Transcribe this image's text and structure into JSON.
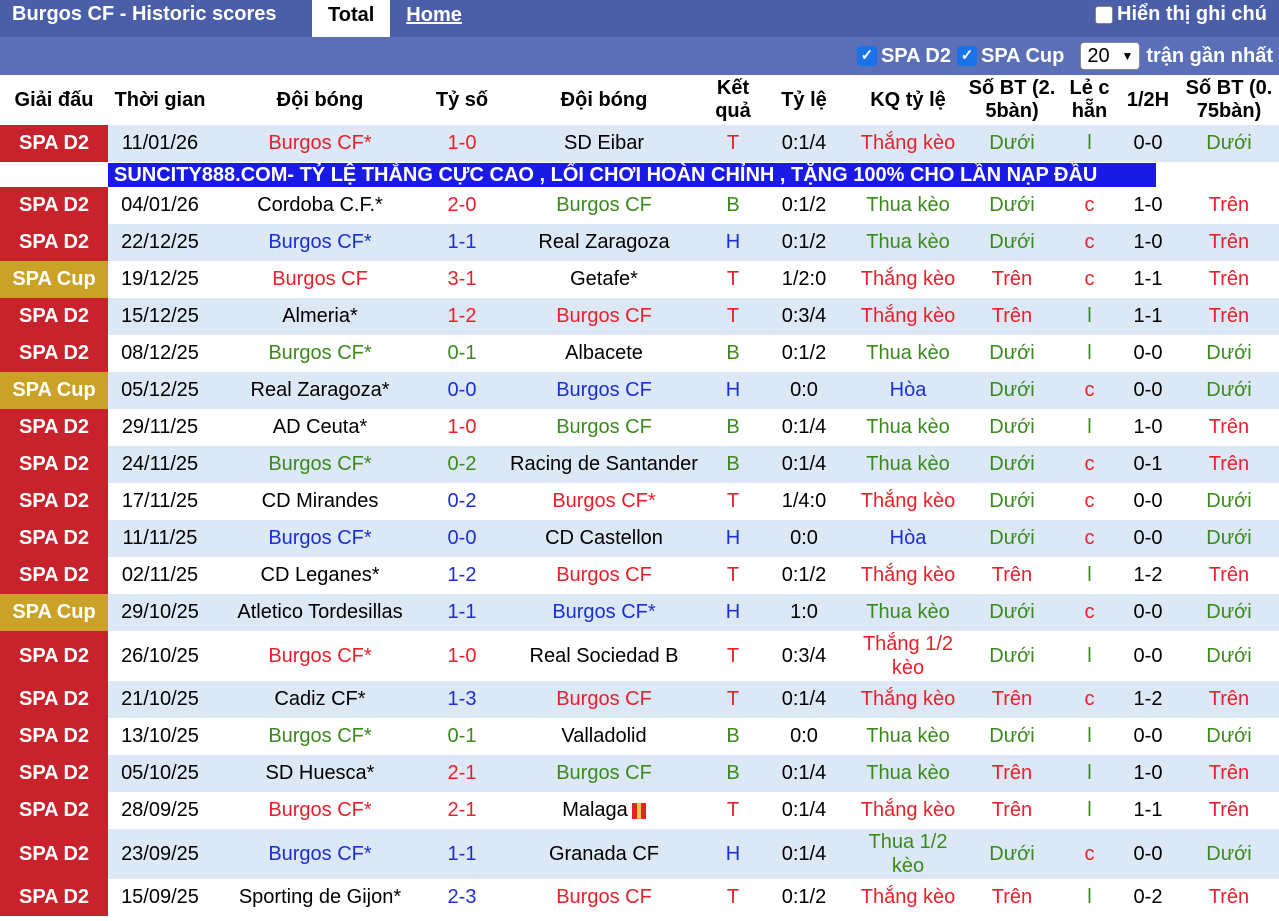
{
  "header": {
    "title": "Burgos CF - Historic scores",
    "tabs": [
      "Total",
      "Home"
    ],
    "toggle_label": "Hiển thị ghi chú"
  },
  "filters": {
    "spa_d2": "SPA D2",
    "spa_cup": "SPA Cup",
    "count_value": "20",
    "count_suffix": "trận gần nhất"
  },
  "columns": [
    "Giải đấu",
    "Thời gian",
    "Đội bóng",
    "Tỷ số",
    "Đội bóng",
    "Kết quả",
    "Tỷ lệ",
    "KQ tỷ lệ",
    "Số BT (2. 5bàn)",
    "Lẻ c hẵn",
    "1/2H",
    "Số BT (0. 75bàn)"
  ],
  "colors": {
    "d2": "#c8232c",
    "cup": "#c9a227",
    "red": "#e8202a",
    "blue": "#1a2fd6",
    "green": "#3a8a1e"
  },
  "ad_text": "SUNCITY888.COM- TỶ LỆ THẮNG CỰC CAO , LỐI CHƠI HOÀN CHỈNH , TẶNG 100% CHO LẦN NẠP ĐẦU",
  "rows": [
    {
      "league": "SPA D2",
      "date": "11/01/26",
      "home": "Burgos CF*",
      "home_c": "red",
      "score": "1-0",
      "score_c": "red",
      "away": "SD Eibar",
      "away_c": "black",
      "res": "T",
      "res_c": "red",
      "odds": "0:1/4",
      "kq": "Thắng kèo",
      "kq_c": "red",
      "bt25": "Dưới",
      "bt25_c": "green",
      "le": "l",
      "le_c": "green",
      "half": "0-0",
      "bt075": "Dưới",
      "bt075_c": "green"
    },
    {
      "league": "SPA D2",
      "date": "04/01/26",
      "home": "Cordoba C.F.*",
      "home_c": "black",
      "score": "2-0",
      "score_c": "red",
      "away": "Burgos CF",
      "away_c": "green",
      "res": "B",
      "res_c": "green",
      "odds": "0:1/2",
      "kq": "Thua kèo",
      "kq_c": "green",
      "bt25": "Dưới",
      "bt25_c": "green",
      "le": "c",
      "le_c": "red",
      "half": "1-0",
      "bt075": "Trên",
      "bt075_c": "red"
    },
    {
      "league": "SPA D2",
      "date": "22/12/25",
      "home": "Burgos CF*",
      "home_c": "blue",
      "score": "1-1",
      "score_c": "blue",
      "away": "Real Zaragoza",
      "away_c": "black",
      "res": "H",
      "res_c": "blue",
      "odds": "0:1/2",
      "kq": "Thua kèo",
      "kq_c": "green",
      "bt25": "Dưới",
      "bt25_c": "green",
      "le": "c",
      "le_c": "red",
      "half": "1-0",
      "bt075": "Trên",
      "bt075_c": "red"
    },
    {
      "league": "SPA Cup",
      "date": "19/12/25",
      "home": "Burgos CF",
      "home_c": "red",
      "score": "3-1",
      "score_c": "red",
      "away": "Getafe*",
      "away_c": "black",
      "res": "T",
      "res_c": "red",
      "odds": "1/2:0",
      "kq": "Thắng kèo",
      "kq_c": "red",
      "bt25": "Trên",
      "bt25_c": "red",
      "le": "c",
      "le_c": "red",
      "half": "1-1",
      "bt075": "Trên",
      "bt075_c": "red"
    },
    {
      "league": "SPA D2",
      "date": "15/12/25",
      "home": "Almeria*",
      "home_c": "black",
      "score": "1-2",
      "score_c": "red",
      "away": "Burgos CF",
      "away_c": "red",
      "res": "T",
      "res_c": "red",
      "odds": "0:3/4",
      "kq": "Thắng kèo",
      "kq_c": "red",
      "bt25": "Trên",
      "bt25_c": "red",
      "le": "l",
      "le_c": "green",
      "half": "1-1",
      "bt075": "Trên",
      "bt075_c": "red"
    },
    {
      "league": "SPA D2",
      "date": "08/12/25",
      "home": "Burgos CF*",
      "home_c": "green",
      "score": "0-1",
      "score_c": "green",
      "away": "Albacete",
      "away_c": "black",
      "res": "B",
      "res_c": "green",
      "odds": "0:1/2",
      "kq": "Thua kèo",
      "kq_c": "green",
      "bt25": "Dưới",
      "bt25_c": "green",
      "le": "l",
      "le_c": "green",
      "half": "0-0",
      "bt075": "Dưới",
      "bt075_c": "green"
    },
    {
      "league": "SPA Cup",
      "date": "05/12/25",
      "home": "Real Zaragoza*",
      "home_c": "black",
      "score": "0-0",
      "score_c": "blue",
      "away": "Burgos CF",
      "away_c": "blue",
      "res": "H",
      "res_c": "blue",
      "odds": "0:0",
      "kq": "Hòa",
      "kq_c": "blue",
      "bt25": "Dưới",
      "bt25_c": "green",
      "le": "c",
      "le_c": "red",
      "half": "0-0",
      "bt075": "Dưới",
      "bt075_c": "green"
    },
    {
      "league": "SPA D2",
      "date": "29/11/25",
      "home": "AD Ceuta*",
      "home_c": "black",
      "score": "1-0",
      "score_c": "red",
      "away": "Burgos CF",
      "away_c": "green",
      "res": "B",
      "res_c": "green",
      "odds": "0:1/4",
      "kq": "Thua kèo",
      "kq_c": "green",
      "bt25": "Dưới",
      "bt25_c": "green",
      "le": "l",
      "le_c": "green",
      "half": "1-0",
      "bt075": "Trên",
      "bt075_c": "red"
    },
    {
      "league": "SPA D2",
      "date": "24/11/25",
      "home": "Burgos CF*",
      "home_c": "green",
      "score": "0-2",
      "score_c": "green",
      "away": "Racing de Santander",
      "away_c": "black",
      "res": "B",
      "res_c": "green",
      "odds": "0:1/4",
      "kq": "Thua kèo",
      "kq_c": "green",
      "bt25": "Dưới",
      "bt25_c": "green",
      "le": "c",
      "le_c": "red",
      "half": "0-1",
      "bt075": "Trên",
      "bt075_c": "red"
    },
    {
      "league": "SPA D2",
      "date": "17/11/25",
      "home": "CD Mirandes",
      "home_c": "black",
      "score": "0-2",
      "score_c": "blue",
      "away": "Burgos CF*",
      "away_c": "red",
      "res": "T",
      "res_c": "red",
      "odds": "1/4:0",
      "kq": "Thắng kèo",
      "kq_c": "red",
      "bt25": "Dưới",
      "bt25_c": "green",
      "le": "c",
      "le_c": "red",
      "half": "0-0",
      "bt075": "Dưới",
      "bt075_c": "green"
    },
    {
      "league": "SPA D2",
      "date": "11/11/25",
      "home": "Burgos CF*",
      "home_c": "blue",
      "score": "0-0",
      "score_c": "blue",
      "away": "CD Castellon",
      "away_c": "black",
      "res": "H",
      "res_c": "blue",
      "odds": "0:0",
      "kq": "Hòa",
      "kq_c": "blue",
      "bt25": "Dưới",
      "bt25_c": "green",
      "le": "c",
      "le_c": "red",
      "half": "0-0",
      "bt075": "Dưới",
      "bt075_c": "green"
    },
    {
      "league": "SPA D2",
      "date": "02/11/25",
      "home": "CD Leganes*",
      "home_c": "black",
      "score": "1-2",
      "score_c": "blue",
      "away": "Burgos CF",
      "away_c": "red",
      "res": "T",
      "res_c": "red",
      "odds": "0:1/2",
      "kq": "Thắng kèo",
      "kq_c": "red",
      "bt25": "Trên",
      "bt25_c": "red",
      "le": "l",
      "le_c": "green",
      "half": "1-2",
      "bt075": "Trên",
      "bt075_c": "red"
    },
    {
      "league": "SPA Cup",
      "date": "29/10/25",
      "home": "Atletico Tordesillas",
      "home_c": "black",
      "score": "1-1",
      "score_c": "blue",
      "away": "Burgos CF*",
      "away_c": "blue",
      "res": "H",
      "res_c": "blue",
      "odds": "1:0",
      "kq": "Thua kèo",
      "kq_c": "green",
      "bt25": "Dưới",
      "bt25_c": "green",
      "le": "c",
      "le_c": "red",
      "half": "0-0",
      "bt075": "Dưới",
      "bt075_c": "green"
    },
    {
      "league": "SPA D2",
      "date": "26/10/25",
      "home": "Burgos CF*",
      "home_c": "red",
      "score": "1-0",
      "score_c": "red",
      "away": "Real Sociedad B",
      "away_c": "black",
      "res": "T",
      "res_c": "red",
      "odds": "0:3/4",
      "kq": "Thắng 1/2 kèo",
      "kq_c": "red",
      "bt25": "Dưới",
      "bt25_c": "green",
      "le": "l",
      "le_c": "green",
      "half": "0-0",
      "bt075": "Dưới",
      "bt075_c": "green",
      "tall": true
    },
    {
      "league": "SPA D2",
      "date": "21/10/25",
      "home": "Cadiz CF*",
      "home_c": "black",
      "score": "1-3",
      "score_c": "blue",
      "away": "Burgos CF",
      "away_c": "red",
      "res": "T",
      "res_c": "red",
      "odds": "0:1/4",
      "kq": "Thắng kèo",
      "kq_c": "red",
      "bt25": "Trên",
      "bt25_c": "red",
      "le": "c",
      "le_c": "red",
      "half": "1-2",
      "bt075": "Trên",
      "bt075_c": "red"
    },
    {
      "league": "SPA D2",
      "date": "13/10/25",
      "home": "Burgos CF*",
      "home_c": "green",
      "score": "0-1",
      "score_c": "green",
      "away": "Valladolid",
      "away_c": "black",
      "res": "B",
      "res_c": "green",
      "odds": "0:0",
      "kq": "Thua kèo",
      "kq_c": "green",
      "bt25": "Dưới",
      "bt25_c": "green",
      "le": "l",
      "le_c": "green",
      "half": "0-0",
      "bt075": "Dưới",
      "bt075_c": "green"
    },
    {
      "league": "SPA D2",
      "date": "05/10/25",
      "home": "SD Huesca*",
      "home_c": "black",
      "score": "2-1",
      "score_c": "red",
      "away": "Burgos CF",
      "away_c": "green",
      "res": "B",
      "res_c": "green",
      "odds": "0:1/4",
      "kq": "Thua kèo",
      "kq_c": "green",
      "bt25": "Trên",
      "bt25_c": "red",
      "le": "l",
      "le_c": "green",
      "half": "1-0",
      "bt075": "Trên",
      "bt075_c": "red"
    },
    {
      "league": "SPA D2",
      "date": "28/09/25",
      "home": "Burgos CF*",
      "home_c": "red",
      "score": "2-1",
      "score_c": "red",
      "away": "Malaga",
      "away_c": "black",
      "away_flag": true,
      "res": "T",
      "res_c": "red",
      "odds": "0:1/4",
      "kq": "Thắng kèo",
      "kq_c": "red",
      "bt25": "Trên",
      "bt25_c": "red",
      "le": "l",
      "le_c": "green",
      "half": "1-1",
      "bt075": "Trên",
      "bt075_c": "red"
    },
    {
      "league": "SPA D2",
      "date": "23/09/25",
      "home": "Burgos CF*",
      "home_c": "blue",
      "score": "1-1",
      "score_c": "blue",
      "away": "Granada CF",
      "away_c": "black",
      "res": "H",
      "res_c": "blue",
      "odds": "0:1/4",
      "kq": "Thua 1/2 kèo",
      "kq_c": "green",
      "bt25": "Dưới",
      "bt25_c": "green",
      "le": "c",
      "le_c": "red",
      "half": "0-0",
      "bt075": "Dưới",
      "bt075_c": "green",
      "tall": true
    },
    {
      "league": "SPA D2",
      "date": "15/09/25",
      "home": "Sporting de Gijon*",
      "home_c": "black",
      "score": "2-3",
      "score_c": "blue",
      "away": "Burgos CF",
      "away_c": "red",
      "res": "T",
      "res_c": "red",
      "odds": "0:1/2",
      "kq": "Thắng kèo",
      "kq_c": "red",
      "bt25": "Trên",
      "bt25_c": "red",
      "le": "l",
      "le_c": "green",
      "half": "0-2",
      "bt075": "Trên",
      "bt075_c": "red"
    }
  ]
}
